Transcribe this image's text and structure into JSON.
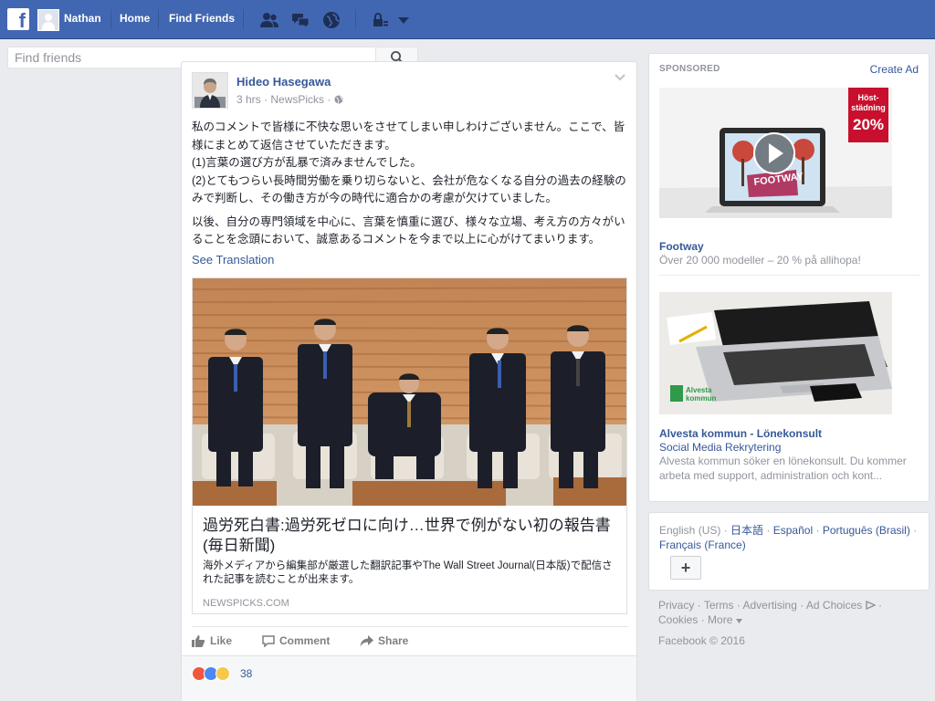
{
  "colors": {
    "brand": "#4267b2",
    "link": "#365899",
    "meta": "#90949c",
    "background": "#e9ebee"
  },
  "topbar": {
    "logo_icon": "facebook-logo",
    "user_name": "Nathan",
    "home_label": "Home",
    "find_friends_label": "Find Friends",
    "icons": [
      "friend-requests-icon",
      "messages-icon",
      "notifications-globe-icon",
      "privacy-lock-icon",
      "account-menu-caret-icon"
    ]
  },
  "search": {
    "placeholder": "Find friends",
    "icon": "search-icon"
  },
  "post": {
    "author": "Hideo Hasegawa",
    "time": "3 hrs",
    "source": "NewsPicks",
    "audience_icon": "globe-icon",
    "paragraphs": [
      "私のコメントで皆様に不快な思いをさせてしまい申しわけございません。ここで、皆様にまとめて返信させていただきます。\n(1)言葉の選び方が乱暴で済みませんでした。\n(2)とてもつらい長時間労働を乗り切らないと、会社が危なくなる自分の過去の経験のみで判断し、その働き方が今の時代に適合かの考慮が欠けていました。",
      "以後、自分の専門領域を中心に、言葉を慎重に選び、様々な立場、考え方の方々がいることを念頭において、誠意あるコメントを今まで以上に心がけてまいります。"
    ],
    "see_translation": "See Translation",
    "link_card": {
      "title": "過労死白書:過労死ゼロに向け…世界で例がない初の報告書(毎日新聞)",
      "description": "海外メディアから編集部が厳選した翻訳記事やThe Wall Street Journal(日本版)で配信された記事を読むことが出来ます。",
      "domain": "NEWSPICKS.COM"
    },
    "actions": {
      "like": "Like",
      "comment": "Comment",
      "share": "Share"
    },
    "reactions": {
      "icons": [
        "angry-reaction-icon",
        "like-reaction-icon",
        "haha-reaction-icon"
      ],
      "count": "38"
    }
  },
  "sidebar": {
    "sponsored_label": "SPONSORED",
    "create_ad": "Create Ad",
    "ads": [
      {
        "badge_line1": "Höst-",
        "badge_line2": "städning",
        "badge_pct": "20%",
        "screen_text": "FOOTWAY",
        "title": "Footway",
        "body": "Över 20 000 modeller – 20 % på allihopa!"
      },
      {
        "logo_text_1": "Alvesta",
        "logo_text_2": "kommun",
        "title": "Alvesta kommun - Lönekonsult",
        "subtitle": "Social Media Rekrytering",
        "body": "Alvesta kommun söker en lönekonsult. Du kommer arbeta med support, administration och kont..."
      }
    ],
    "languages": {
      "current": "English (US)",
      "others": [
        "日本語",
        "Español",
        "Português (Brasil)",
        "Français (France)"
      ],
      "add_button": "+"
    },
    "footer_links": [
      "Privacy",
      "Terms",
      "Advertising",
      "Ad Choices",
      "Cookies",
      "More"
    ],
    "copyright": "Facebook © 2016"
  }
}
